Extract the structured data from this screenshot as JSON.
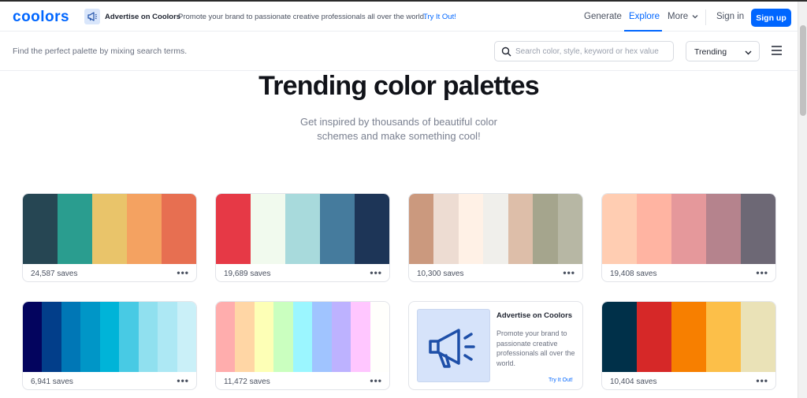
{
  "header": {
    "logo": "coolors",
    "ad_title": "Advertise on Coolors",
    "ad_text": "Promote your brand to passionate creative professionals all over the world.",
    "ad_link": "Try It Out!",
    "nav": {
      "generate": "Generate",
      "explore": "Explore",
      "more": "More",
      "signin": "Sign in",
      "signup": "Sign up"
    }
  },
  "subbar": {
    "hint": "Find the perfect palette by mixing search terms.",
    "search_placeholder": "Search color, style, keyword or hex value",
    "sort_value": "Trending"
  },
  "hero": {
    "title": "Trending color palettes",
    "subtitle": "Get inspired by thousands of beautiful color schemes and make something cool!"
  },
  "palettes": [
    {
      "saves": "24,587 saves",
      "colors": [
        "#264653",
        "#2a9d8f",
        "#e9c46a",
        "#f4a261",
        "#e76f51"
      ]
    },
    {
      "saves": "19,689 saves",
      "colors": [
        "#e63946",
        "#f1faee",
        "#a8dadc",
        "#457b9d",
        "#1d3557"
      ]
    },
    {
      "saves": "10,300 saves",
      "colors": [
        "#cb997e",
        "#eddcd2",
        "#fff1e6",
        "#f0efeb",
        "#ddbea9",
        "#a5a58d",
        "#b7b7a4"
      ]
    },
    {
      "saves": "19,408 saves",
      "colors": [
        "#ffcdb2",
        "#ffb4a2",
        "#e5989b",
        "#b5838d",
        "#6d6875"
      ]
    },
    {
      "saves": "6,941 saves",
      "colors": [
        "#03045e",
        "#023e8a",
        "#0077b6",
        "#0096c7",
        "#00b4d8",
        "#48cae4",
        "#90e0ef",
        "#ade8f4",
        "#caf0f8"
      ]
    },
    {
      "saves": "11,472 saves",
      "colors": [
        "#ffadad",
        "#ffd6a5",
        "#fdffb6",
        "#caffbf",
        "#9bf6ff",
        "#a0c4ff",
        "#bdb2ff",
        "#ffc6ff",
        "#fffffc"
      ]
    },
    {
      "saves": "10,404 saves",
      "colors": [
        "#003049",
        "#d62828",
        "#f77f00",
        "#fcbf49",
        "#eae2b7"
      ]
    }
  ],
  "ad_card": {
    "title": "Advertise on Coolors",
    "text": "Promote your brand to passionate creative professionals all over the world.",
    "link": "Try It Out!"
  },
  "colors": {
    "accent": "#0066ff"
  },
  "icons": [
    "megaphone-icon",
    "chevron-down-icon",
    "search-icon",
    "hamburger-menu-icon",
    "more-dots-icon"
  ]
}
